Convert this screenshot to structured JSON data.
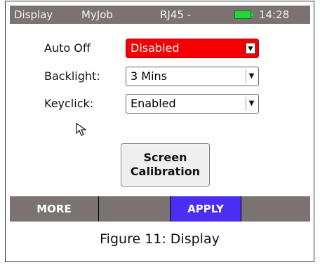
{
  "statusbar": {
    "app": "Display",
    "job": "MyJob",
    "port": "RJ45 -",
    "time": "14:28",
    "battery_icon": "battery-full-icon"
  },
  "settings": [
    {
      "label": "Auto Off",
      "value": "Disabled"
    },
    {
      "label": "Backlight:",
      "value": "3 Mins"
    },
    {
      "label": "Keyclick:",
      "value": "Enabled"
    }
  ],
  "calibration_button": {
    "line1": "Screen",
    "line2": "Calibration"
  },
  "softkeys": [
    {
      "label": "MORE"
    },
    {
      "label": ""
    },
    {
      "label": "APPLY"
    },
    {
      "label": ""
    }
  ],
  "caption": "Figure 11: Display",
  "colors": {
    "statusbar": "#7a7371",
    "highlight_red": "#f40000",
    "apply_blue": "#4a2ef2",
    "battery_green": "#24d63a"
  }
}
